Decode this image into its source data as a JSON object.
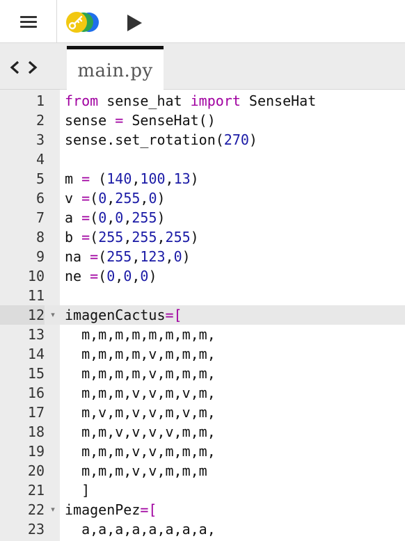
{
  "toolbar": {
    "menu_icon": "hamburger-menu-icon",
    "logo_icon": "key-logo-icon",
    "logo_colors": [
      "#f2c811",
      "#2ea44f",
      "#1f6feb"
    ],
    "run_icon": "play-icon"
  },
  "tabs": {
    "nav_back_icon": "chevron-left-icon",
    "nav_forward_icon": "chevron-right-icon",
    "active_tab": "main.py"
  },
  "editor": {
    "active_line": 12,
    "lines": [
      {
        "n": "1",
        "fold": false,
        "tokens": [
          {
            "t": "from",
            "c": "kw"
          },
          {
            "t": " sense_hat ",
            "c": ""
          },
          {
            "t": "import",
            "c": "kw"
          },
          {
            "t": " SenseHat",
            "c": ""
          }
        ]
      },
      {
        "n": "2",
        "fold": false,
        "tokens": [
          {
            "t": "sense ",
            "c": ""
          },
          {
            "t": "=",
            "c": "op"
          },
          {
            "t": " SenseHat()",
            "c": ""
          }
        ]
      },
      {
        "n": "3",
        "fold": false,
        "tokens": [
          {
            "t": "sense.set_rotation(",
            "c": ""
          },
          {
            "t": "270",
            "c": "num"
          },
          {
            "t": ")",
            "c": ""
          }
        ]
      },
      {
        "n": "4",
        "fold": false,
        "tokens": []
      },
      {
        "n": "5",
        "fold": false,
        "tokens": [
          {
            "t": "m ",
            "c": ""
          },
          {
            "t": "=",
            "c": "op"
          },
          {
            "t": " (",
            "c": ""
          },
          {
            "t": "140",
            "c": "num"
          },
          {
            "t": ",",
            "c": ""
          },
          {
            "t": "100",
            "c": "num"
          },
          {
            "t": ",",
            "c": ""
          },
          {
            "t": "13",
            "c": "num"
          },
          {
            "t": ")",
            "c": ""
          }
        ]
      },
      {
        "n": "6",
        "fold": false,
        "tokens": [
          {
            "t": "v ",
            "c": ""
          },
          {
            "t": "=",
            "c": "op"
          },
          {
            "t": "(",
            "c": ""
          },
          {
            "t": "0",
            "c": "num"
          },
          {
            "t": ",",
            "c": ""
          },
          {
            "t": "255",
            "c": "num"
          },
          {
            "t": ",",
            "c": ""
          },
          {
            "t": "0",
            "c": "num"
          },
          {
            "t": ")",
            "c": ""
          }
        ]
      },
      {
        "n": "7",
        "fold": false,
        "tokens": [
          {
            "t": "a ",
            "c": ""
          },
          {
            "t": "=",
            "c": "op"
          },
          {
            "t": "(",
            "c": ""
          },
          {
            "t": "0",
            "c": "num"
          },
          {
            "t": ",",
            "c": ""
          },
          {
            "t": "0",
            "c": "num"
          },
          {
            "t": ",",
            "c": ""
          },
          {
            "t": "255",
            "c": "num"
          },
          {
            "t": ")",
            "c": ""
          }
        ]
      },
      {
        "n": "8",
        "fold": false,
        "tokens": [
          {
            "t": "b ",
            "c": ""
          },
          {
            "t": "=",
            "c": "op"
          },
          {
            "t": "(",
            "c": ""
          },
          {
            "t": "255",
            "c": "num"
          },
          {
            "t": ",",
            "c": ""
          },
          {
            "t": "255",
            "c": "num"
          },
          {
            "t": ",",
            "c": ""
          },
          {
            "t": "255",
            "c": "num"
          },
          {
            "t": ")",
            "c": ""
          }
        ]
      },
      {
        "n": "9",
        "fold": false,
        "tokens": [
          {
            "t": "na ",
            "c": ""
          },
          {
            "t": "=",
            "c": "op"
          },
          {
            "t": "(",
            "c": ""
          },
          {
            "t": "255",
            "c": "num"
          },
          {
            "t": ",",
            "c": ""
          },
          {
            "t": "123",
            "c": "num"
          },
          {
            "t": ",",
            "c": ""
          },
          {
            "t": "0",
            "c": "num"
          },
          {
            "t": ")",
            "c": ""
          }
        ]
      },
      {
        "n": "10",
        "fold": false,
        "tokens": [
          {
            "t": "ne ",
            "c": ""
          },
          {
            "t": "=",
            "c": "op"
          },
          {
            "t": "(",
            "c": ""
          },
          {
            "t": "0",
            "c": "num"
          },
          {
            "t": ",",
            "c": ""
          },
          {
            "t": "0",
            "c": "num"
          },
          {
            "t": ",",
            "c": ""
          },
          {
            "t": "0",
            "c": "num"
          },
          {
            "t": ")",
            "c": ""
          }
        ]
      },
      {
        "n": "11",
        "fold": false,
        "tokens": []
      },
      {
        "n": "12",
        "fold": true,
        "tokens": [
          {
            "t": "imagenCactus",
            "c": ""
          },
          {
            "t": "=",
            "c": "op"
          },
          {
            "t": "[",
            "c": "op"
          }
        ]
      },
      {
        "n": "13",
        "fold": false,
        "tokens": [
          {
            "t": "  m,m,m,m,m,m,m,m,",
            "c": ""
          }
        ]
      },
      {
        "n": "14",
        "fold": false,
        "tokens": [
          {
            "t": "  m,m,m,m,v,m,m,m,",
            "c": ""
          }
        ]
      },
      {
        "n": "15",
        "fold": false,
        "tokens": [
          {
            "t": "  m,m,m,m,v,m,m,m,",
            "c": ""
          }
        ]
      },
      {
        "n": "16",
        "fold": false,
        "tokens": [
          {
            "t": "  m,m,m,v,v,m,v,m,",
            "c": ""
          }
        ]
      },
      {
        "n": "17",
        "fold": false,
        "tokens": [
          {
            "t": "  m,v,m,v,v,m,v,m,",
            "c": ""
          }
        ]
      },
      {
        "n": "18",
        "fold": false,
        "tokens": [
          {
            "t": "  m,m,v,v,v,v,m,m,",
            "c": ""
          }
        ]
      },
      {
        "n": "19",
        "fold": false,
        "tokens": [
          {
            "t": "  m,m,m,v,v,m,m,m,",
            "c": ""
          }
        ]
      },
      {
        "n": "20",
        "fold": false,
        "tokens": [
          {
            "t": "  m,m,m,v,v,m,m,m",
            "c": ""
          }
        ]
      },
      {
        "n": "21",
        "fold": false,
        "tokens": [
          {
            "t": "  ]",
            "c": ""
          }
        ]
      },
      {
        "n": "22",
        "fold": true,
        "tokens": [
          {
            "t": "imagenPez",
            "c": ""
          },
          {
            "t": "=",
            "c": "op"
          },
          {
            "t": "[",
            "c": "op"
          }
        ]
      },
      {
        "n": "23",
        "fold": false,
        "tokens": [
          {
            "t": "  a,a,a,a,a,a,a,a,",
            "c": ""
          }
        ]
      }
    ]
  }
}
